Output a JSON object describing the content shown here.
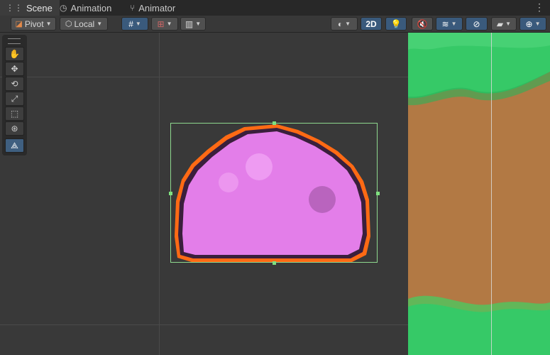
{
  "tabs": [
    {
      "label": "Scene",
      "icon": "grid-icon"
    },
    {
      "label": "Animation",
      "icon": "clock-icon"
    },
    {
      "label": "Animator",
      "icon": "branch-icon"
    }
  ],
  "toolbar": {
    "pivot_label": "Pivot",
    "local_label": "Local",
    "mode_2d_label": "2D"
  },
  "colors": {
    "slime_fill": "#e37ee9",
    "slime_outline": "#ff6a14",
    "selection": "#8ed88e",
    "grass": "#3ccd6a",
    "dirt": "#b57a44"
  }
}
